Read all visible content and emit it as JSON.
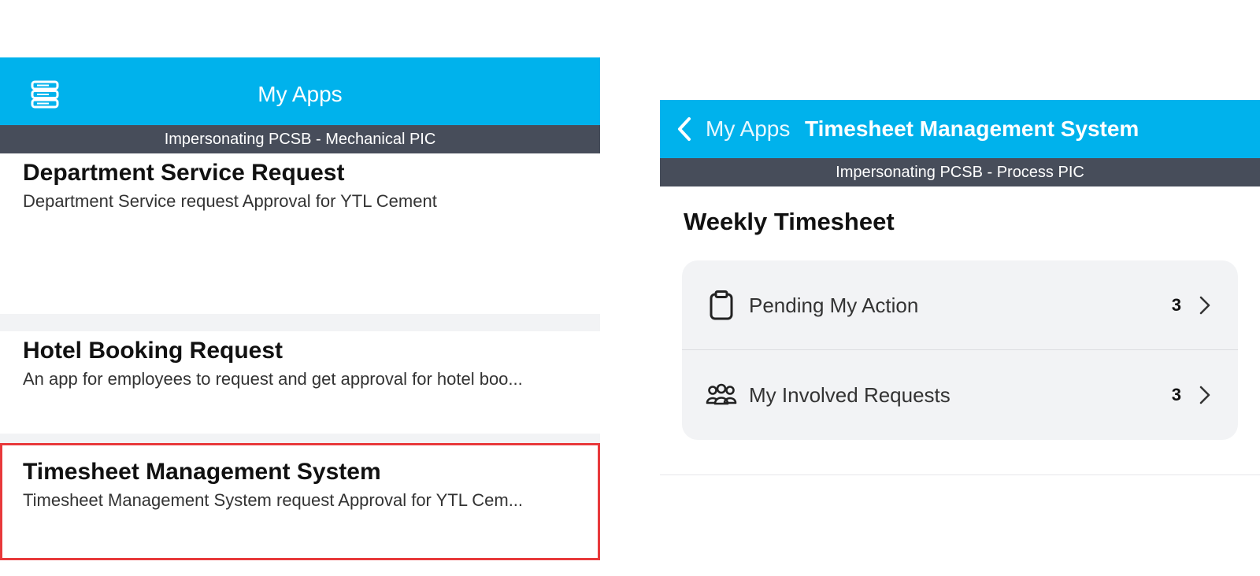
{
  "left_screen": {
    "header": {
      "title": "My Apps",
      "menu_icon": "server-stack-icon"
    },
    "impersonation_banner": "Impersonating PCSB - Mechanical PIC",
    "apps": [
      {
        "title": "Department Service Request",
        "description": "Department Service request Approval for YTL Cement"
      },
      {
        "title": "Hotel Booking Request",
        "description": "An app for employees to request and get approval for hotel boo..."
      },
      {
        "title": "Timesheet Management System",
        "description": "Timesheet Management System request Approval for YTL Cem...",
        "highlighted": true
      }
    ],
    "highlight_color": "#e8393b"
  },
  "right_screen": {
    "header": {
      "back_label": "My Apps",
      "title": "Timesheet Management System",
      "back_icon": "chevron-left-icon"
    },
    "impersonation_banner": "Impersonating PCSB - Process PIC",
    "section_title": "Weekly Timesheet",
    "menu": [
      {
        "label": "Pending My Action",
        "count": "3",
        "icon": "clipboard-icon"
      },
      {
        "label": "My Involved Requests",
        "count": "3",
        "icon": "users-group-icon"
      }
    ]
  },
  "colors": {
    "header_blue": "#00b2ec",
    "banner_gray": "#474d5a",
    "card_gray": "#f2f3f5"
  }
}
